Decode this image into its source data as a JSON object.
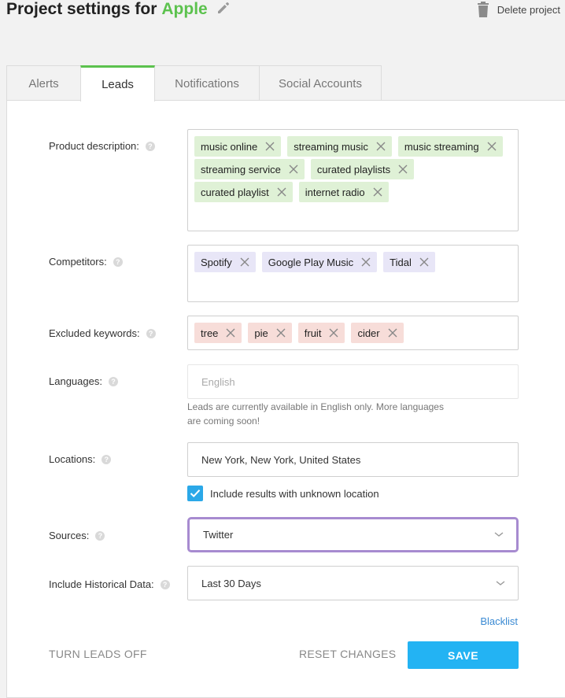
{
  "header": {
    "title_prefix": "Project settings for",
    "project_name": "Apple",
    "delete_label": "Delete project",
    "accent_color": "#5cc24e"
  },
  "tabs": [
    {
      "label": "Alerts",
      "active": false
    },
    {
      "label": "Leads",
      "active": true
    },
    {
      "label": "Notifications",
      "active": false
    },
    {
      "label": "Social Accounts",
      "active": false
    }
  ],
  "form": {
    "product_description": {
      "label": "Product description:",
      "tags": [
        "music online",
        "streaming music",
        "music streaming",
        "streaming service",
        "curated playlists",
        "curated playlist",
        "internet radio"
      ]
    },
    "competitors": {
      "label": "Competitors:",
      "tags": [
        "Spotify",
        "Google Play Music",
        "Tidal"
      ]
    },
    "excluded_keywords": {
      "label": "Excluded keywords:",
      "tags": [
        "tree",
        "pie",
        "fruit",
        "cider"
      ]
    },
    "languages": {
      "label": "Languages:",
      "placeholder": "English",
      "note": "Leads are currently available in English only. More languages are coming soon!"
    },
    "locations": {
      "label": "Locations:",
      "value": "New York, New York, United States",
      "unknown_location_label": "Include results with unknown location",
      "unknown_location_checked": true
    },
    "sources": {
      "label": "Sources:",
      "value": "Twitter"
    },
    "historical": {
      "label": "Include Historical Data:",
      "value": "Last 30 Days"
    },
    "blacklist_label": "Blacklist"
  },
  "footer": {
    "turn_off_label": "TURN LEADS OFF",
    "reset_label": "RESET CHANGES",
    "save_label": "SAVE",
    "save_color": "#23b3f3"
  }
}
